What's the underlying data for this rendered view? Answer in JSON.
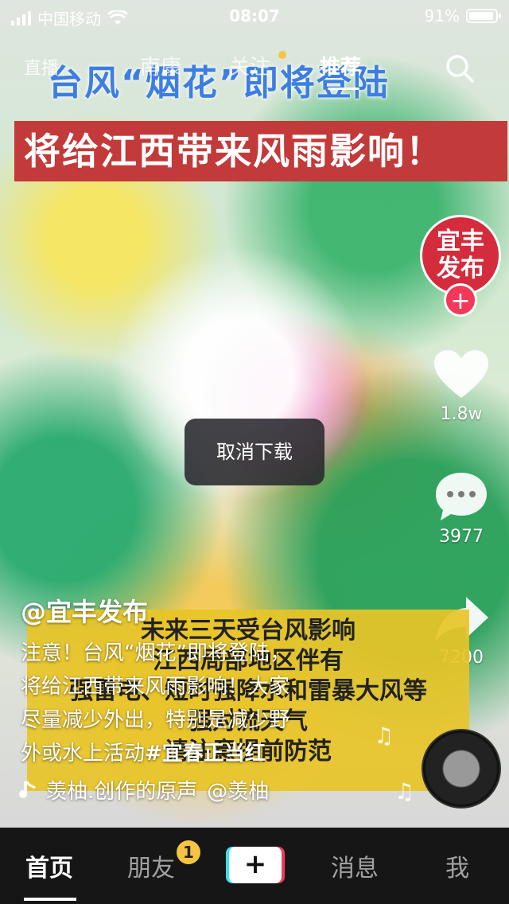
{
  "status_bar": {
    "carrier": "中国移动",
    "time": "08:07",
    "battery": "91%"
  },
  "top_tabs": {
    "live": "直播",
    "items": [
      "南康",
      "关注",
      "推荐"
    ],
    "active": "推荐"
  },
  "video": {
    "headline_top": "台风“烟花”即将登陆",
    "headline_banner": "将给江西带来风雨影响！",
    "info_lines": [
      "未来三天受台风影响",
      "江西局部地区伴有",
      "强雷电、短时强降水和雷暴大风等",
      "强对流天气",
      "请注意提前防范"
    ]
  },
  "creator": {
    "avatar_text_line1": "宜丰",
    "avatar_text_line2": "发布",
    "follow_symbol": "+"
  },
  "actions": {
    "likes": "1.8w",
    "comments": "3977",
    "shares": "7200"
  },
  "toast": "取消下载",
  "post": {
    "author": "@宜丰发布",
    "description_lines": [
      "注意！台风“烟花”即将登陆，",
      "将给江西带来风雨影响！大家",
      "尽量减少外出，特别是减少野"
    ],
    "description_last_prefix": "外或水上活动",
    "hashtag": "#宜春正当红",
    "music": "羡柚.创作的原声",
    "music_author": "@羡柚"
  },
  "bottom_nav": {
    "home": "首页",
    "friends": "朋友",
    "friends_badge": "1",
    "create": "+",
    "messages": "消息",
    "me": "我"
  },
  "colors": {
    "banner_red": "#c23a3a",
    "info_yellow": "#e8c428",
    "accent_pink": "#f3385a",
    "accent_cyan": "#3ce0ea"
  }
}
